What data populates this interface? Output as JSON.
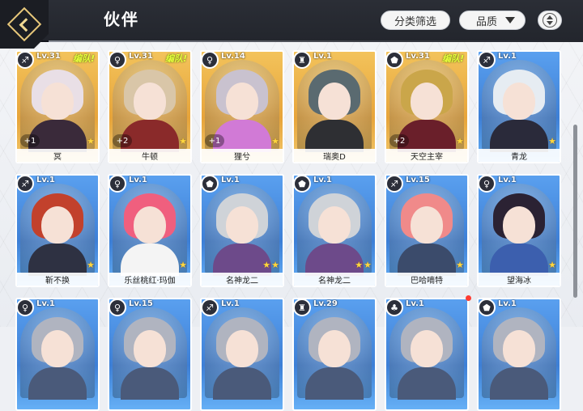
{
  "header": {
    "title": "伙伴",
    "filter_label": "分类筛选",
    "quality_label": "品质",
    "back_icon": "back-diamond-icon",
    "sort_icon": "sort-toggle-icon"
  },
  "cards": [
    {
      "name": "冥",
      "level": "Lv.31",
      "team": "编队!",
      "plus": "+1",
      "stars": 1,
      "frame": "gold",
      "class": "♐",
      "hair": "#e9dfe6",
      "body": "#3a2a3a"
    },
    {
      "name": "牛顿",
      "level": "Lv.31",
      "team": "编队!",
      "plus": "+2",
      "stars": 1,
      "frame": "gold",
      "class": "♀",
      "hair": "#d9c6a8",
      "body": "#8a2a2a"
    },
    {
      "name": "狸兮",
      "level": "Lv.14",
      "team": "",
      "plus": "+1",
      "stars": 1,
      "frame": "gold",
      "class": "♀",
      "hair": "#c9c2cf",
      "body": "#d17ad6"
    },
    {
      "name": "瑞奥D",
      "level": "Lv.1",
      "team": "",
      "plus": "",
      "stars": 0,
      "frame": "gold",
      "class": "♜",
      "hair": "#5a6a70",
      "body": "#2e2f33"
    },
    {
      "name": "天空主宰",
      "level": "Lv.31",
      "team": "编队!",
      "plus": "+2",
      "stars": 1,
      "frame": "gold",
      "class": "⬟",
      "hair": "#caa64a",
      "body": "#6a1f2a"
    },
    {
      "name": "青龙",
      "level": "Lv.1",
      "team": "",
      "plus": "",
      "stars": 1,
      "frame": "blue",
      "class": "♐",
      "hair": "#e6ecf2",
      "body": "#2a2a3a"
    },
    {
      "name": "靳不换",
      "level": "Lv.1",
      "team": "",
      "plus": "",
      "stars": 1,
      "frame": "blue",
      "class": "♐",
      "hair": "#c2412c",
      "body": "#2e3142"
    },
    {
      "name": "乐丝桃红·玛伽",
      "level": "Lv.1",
      "team": "",
      "plus": "",
      "stars": 1,
      "frame": "blue",
      "class": "♀",
      "hair": "#f05f7e",
      "body": "#f4f4f4"
    },
    {
      "name": "名神龙二",
      "level": "Lv.1",
      "team": "",
      "plus": "",
      "stars": 2,
      "frame": "blue",
      "class": "⬟",
      "hair": "#cfd3d8",
      "body": "#6d4a8a"
    },
    {
      "name": "名神龙二",
      "level": "Lv.1",
      "team": "",
      "plus": "",
      "stars": 2,
      "frame": "blue",
      "class": "⬟",
      "hair": "#cfd3d8",
      "body": "#6d4a8a"
    },
    {
      "name": "巴哈嘀特",
      "level": "Lv.15",
      "team": "",
      "plus": "",
      "stars": 1,
      "frame": "blue",
      "class": "♐",
      "hair": "#f08a8a",
      "body": "#3b4b6b"
    },
    {
      "name": "望海冰",
      "level": "Lv.1",
      "team": "",
      "plus": "",
      "stars": 1,
      "frame": "blue",
      "class": "♀",
      "hair": "#2b2233",
      "body": "#3c5fae"
    },
    {
      "name": "",
      "level": "Lv.1",
      "team": "",
      "plus": "",
      "stars": 0,
      "frame": "blue",
      "class": "♀",
      "hair": "#b0b4c0",
      "body": "#4a5a7a"
    },
    {
      "name": "",
      "level": "Lv.15",
      "team": "",
      "plus": "",
      "stars": 0,
      "frame": "blue",
      "class": "♀",
      "hair": "#b0b4c0",
      "body": "#4a5a7a"
    },
    {
      "name": "",
      "level": "Lv.1",
      "team": "",
      "plus": "",
      "stars": 0,
      "frame": "blue",
      "class": "♐",
      "hair": "#b0b4c0",
      "body": "#4a5a7a"
    },
    {
      "name": "",
      "level": "Lv.29",
      "team": "",
      "plus": "",
      "stars": 0,
      "frame": "blue",
      "class": "♜",
      "hair": "#b0b4c0",
      "body": "#4a5a7a"
    },
    {
      "name": "",
      "level": "Lv.1",
      "team": "",
      "plus": "",
      "stars": 0,
      "frame": "blue",
      "class": "♣",
      "hair": "#b0b4c0",
      "body": "#4a5a7a"
    },
    {
      "name": "",
      "level": "Lv.1",
      "team": "",
      "plus": "",
      "stars": 0,
      "frame": "blue",
      "class": "⬟",
      "hair": "#b0b4c0",
      "body": "#4a5a7a"
    }
  ]
}
